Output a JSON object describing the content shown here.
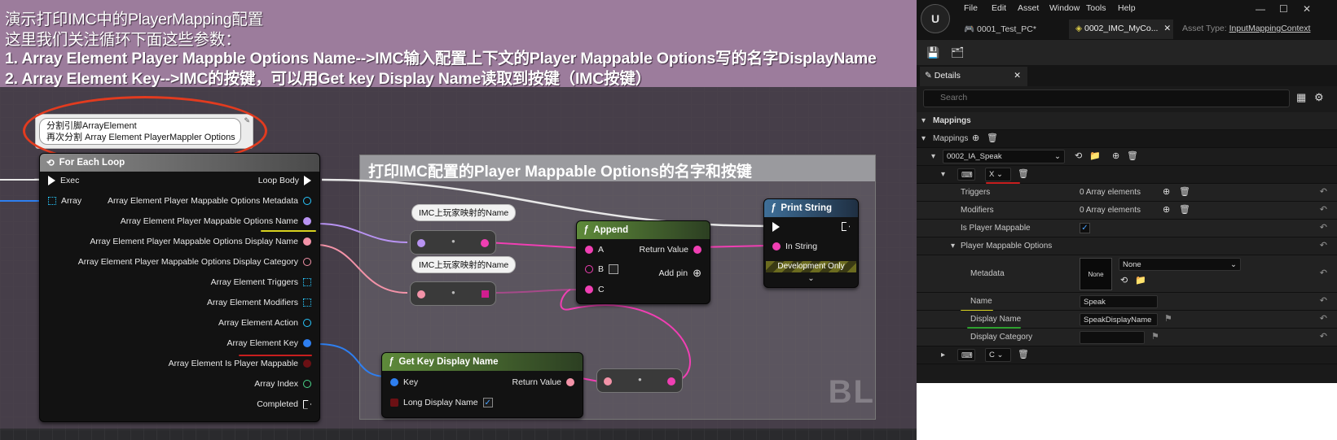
{
  "banner": {
    "line1": "演示打印IMC中的PlayerMapping配置",
    "line2": "这里我们关注循环下面这些参数：",
    "line3": "1. Array Element Player Mappble Options Name-->IMC输入配置上下文的Player Mappable Options写的名字DisplayName",
    "line4": "2. Array Element Key-->IMC的按键，可以用Get key Display Name读取到按键（IMC按键）"
  },
  "note": {
    "line1": "分割引脚ArrayElement",
    "line2": "再次分割 Array Element PlayerMappler Options"
  },
  "comment": {
    "title": "打印IMC配置的Player Mappable Options的名字和按键",
    "watermark": "BL"
  },
  "foreach": {
    "title": "For Each Loop",
    "exec": "Exec",
    "array": "Array",
    "loop_body": "Loop Body",
    "outputs": [
      "Array Element Player Mappable Options Metadata",
      "Array Element Player Mappable Options Name",
      "Array Element Player Mappable Options Display Name",
      "Array Element Player Mappable Options Display Category",
      "Array Element Triggers",
      "Array Element Modifiers",
      "Array Element Action",
      "Array Element Key",
      "Array Element Is Player Mappable",
      "Array Index",
      "Completed"
    ]
  },
  "tags": {
    "tag1": "IMC上玩家映射的Name",
    "tag2": "IMC上玩家映射的Name"
  },
  "append": {
    "title": "Append",
    "a": "A",
    "b": "B",
    "c": "C",
    "return": "Return Value",
    "add_pin": "Add pin"
  },
  "print": {
    "title": "Print String",
    "in_string": "In String",
    "dev": "Development Only"
  },
  "getkey": {
    "title": "Get Key Display Name",
    "key": "Key",
    "return": "Return Value",
    "long": "Long Display Name"
  },
  "editor": {
    "menu": [
      "File",
      "Edit",
      "Asset",
      "Window",
      "Tools",
      "Help"
    ],
    "tab1": "0001_Test_PC*",
    "tab2": "0002_IMC_MyCo...",
    "asset_type_label": "Asset Type:",
    "asset_type": "InputMappingContext",
    "details_tab": "Details",
    "search_placeholder": "Search",
    "mappings_section": "Mappings",
    "mappings_label": "Mappings",
    "action": "0002_IA_Speak",
    "key1": "X",
    "triggers": "Triggers",
    "triggers_val": "0 Array elements",
    "modifiers": "Modifiers",
    "modifiers_val": "0 Array elements",
    "is_player_mappable": "Is Player Mappable",
    "player_mappable_options": "Player Mappable Options",
    "metadata": "Metadata",
    "metadata_thumb": "None",
    "metadata_val": "None",
    "name": "Name",
    "name_val": "Speak",
    "display_name": "Display Name",
    "display_name_val": "SpeakDisplayName",
    "display_category": "Display Category",
    "display_category_val": "",
    "key2": "C"
  }
}
